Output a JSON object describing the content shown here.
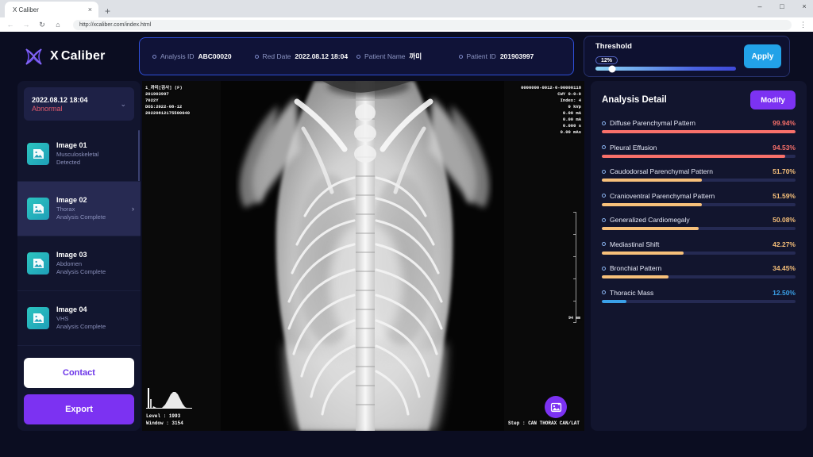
{
  "browser": {
    "tab_title": "X Caliber",
    "tab_close": "×",
    "new_tab": "+",
    "back": "←",
    "forward": "→",
    "reload": "↻",
    "home": "⌂",
    "url": "http://xcaliber.com/index.html",
    "minimize": "–",
    "maximize": "□",
    "close": "×",
    "menu": "⋮"
  },
  "header": {
    "logo_text_a": "X",
    "logo_text_b": "Caliber",
    "info": [
      {
        "label": "Analysis ID",
        "value": "ABC00020"
      },
      {
        "label": "Red Date",
        "value": "2022.08.12 18:04"
      },
      {
        "label": "Patient Name",
        "value": "까미"
      },
      {
        "label": "Patient ID",
        "value": "201903997"
      }
    ],
    "threshold": {
      "title": "Threshold",
      "badge": "12%",
      "percent": 12,
      "apply_label": "Apply"
    }
  },
  "sidebar": {
    "date_selector": {
      "date": "2022.08.12 18:04",
      "status": "Abnormal",
      "chevron": "⌄"
    },
    "images": [
      {
        "title": "Image 01",
        "region": "Musculoskeletal",
        "status": "Detected",
        "active": false
      },
      {
        "title": "Image 02",
        "region": "Thorax",
        "status": "Analysis Complete",
        "active": true
      },
      {
        "title": "Image 03",
        "region": "Abdomen",
        "status": "Analysis Complete",
        "active": false
      },
      {
        "title": "Image 04",
        "region": "VHS",
        "status": "Analysis Complete",
        "active": false
      }
    ],
    "chevron": "›",
    "contact_label": "Contact",
    "export_label": "Export"
  },
  "viewer": {
    "overlay_top_left": "1_까미[검사] (F)\n201903997\n7022Y\nDOS:2022-08-12\n20220812175500040",
    "overlay_top_right": "0000000-0012-0-00000118\nCWY 0-0-0\nIndex: 4\n0 kVp\n0.00 mA\n0.00 mA\n0.000 s\n0.00 mAs",
    "scale_mm": "94 mm",
    "level": "Level : 1993",
    "window": "Window : 3154",
    "step": "Step : CAN THORAX CAN/LAT",
    "fab_icon": "image-analysis-icon"
  },
  "detail": {
    "title": "Analysis Detail",
    "modify_label": "Modify",
    "colors": {
      "high": "#f8706a",
      "medium": "#f7c07a",
      "low": "#3aa0e8"
    },
    "findings": [
      {
        "name": "Diffuse Parenchymal Pattern",
        "value": "99.94%",
        "percent": 99.94,
        "level": "high"
      },
      {
        "name": "Pleural Effusion",
        "value": "94.53%",
        "percent": 94.53,
        "level": "high"
      },
      {
        "name": "Caudodorsal Parenchymal Pattern",
        "value": "51.70%",
        "percent": 51.7,
        "level": "medium"
      },
      {
        "name": "Cranioventral Parenchymal Pattern",
        "value": "51.59%",
        "percent": 51.59,
        "level": "medium"
      },
      {
        "name": "Generalized Cardiomegaly",
        "value": "50.08%",
        "percent": 50.08,
        "level": "medium"
      },
      {
        "name": "Mediastinal Shift",
        "value": "42.27%",
        "percent": 42.27,
        "level": "medium"
      },
      {
        "name": "Bronchial Pattern",
        "value": "34.45%",
        "percent": 34.45,
        "level": "medium"
      },
      {
        "name": "Thoracic Mass",
        "value": "12.50%",
        "percent": 12.5,
        "level": "low"
      }
    ]
  }
}
